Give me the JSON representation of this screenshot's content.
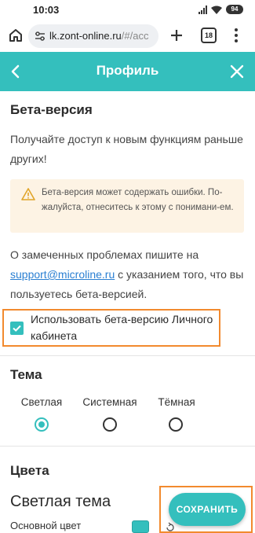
{
  "status_bar": {
    "time": "10:03",
    "battery": "94"
  },
  "browser": {
    "url_host": "lk.zont-online.ru",
    "url_path": "/#/acc",
    "tab_count": "18"
  },
  "header": {
    "title": "Профиль",
    "color": "#34bfbd"
  },
  "beta": {
    "title": "Бета-версия",
    "description": "Получайте доступ к новым функциям раньше других!",
    "warning": "Бета-версия может содержать ошибки. По-жалуйста, отнеситесь к этому с понимани-ем.",
    "report_prefix": "О замеченных проблемах пишите на",
    "email": "support@microline.ru",
    "report_suffix": " с указанием того, что вы пользуетесь бета-версией.",
    "checkbox_label": "Использовать бета-версию Личного кабинета",
    "checkbox_checked": true
  },
  "theme": {
    "title": "Тема",
    "options": [
      {
        "label": "Светлая",
        "selected": true
      },
      {
        "label": "Системная",
        "selected": false
      },
      {
        "label": "Тёмная",
        "selected": false
      }
    ]
  },
  "colors": {
    "title": "Цвета",
    "subtitle": "Светлая тема",
    "primary_label": "Основной цвет",
    "primary_color": "#34bfbd"
  },
  "save_button": "СОХРАНИТЬ",
  "highlight_color": "#f28a2e"
}
